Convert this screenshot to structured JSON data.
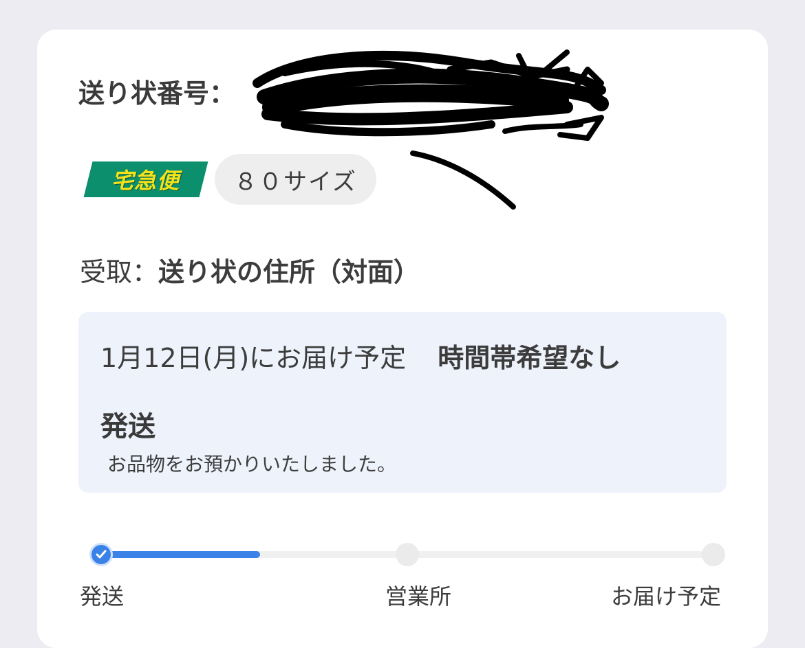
{
  "shipment": {
    "tracking_label": "送り状番号：",
    "carrier_logo_text": "宅急便",
    "carrier_logo_color": "#0c8f6c",
    "size_label": "８０サイズ",
    "receive_label": "受取：",
    "receive_value": "送り状の住所（対面）"
  },
  "status_box": {
    "delivery_date": "1月12日(月)にお届け予定",
    "time_preference": "時間帯希望なし",
    "status_title": "発送",
    "status_description": "お品物をお預かりいたしました。"
  },
  "progress": {
    "accent_color": "#3b82e8",
    "current_step": 1,
    "completed_fraction": 0.26,
    "steps": [
      {
        "label": "発送",
        "done": true
      },
      {
        "label": "営業所",
        "done": false
      },
      {
        "label": "お届け予定",
        "done": false
      }
    ]
  }
}
